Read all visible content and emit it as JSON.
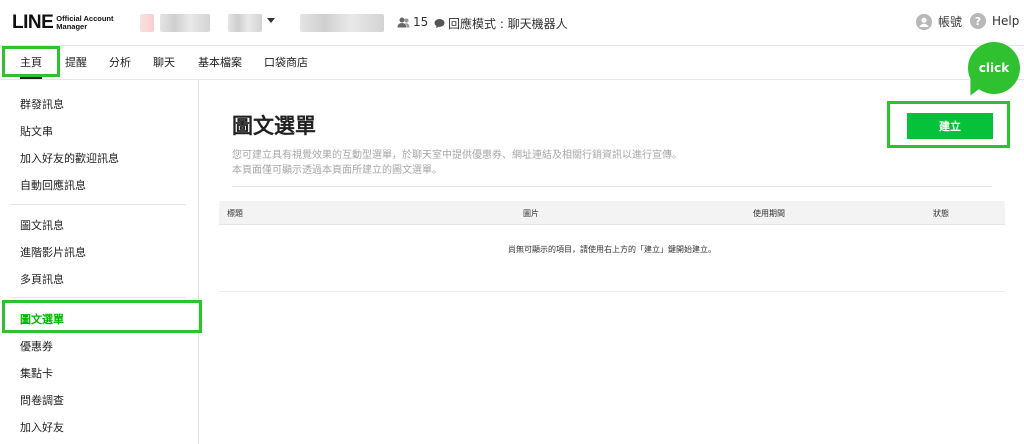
{
  "header": {
    "logo_main": "LINE",
    "logo_sub": "Official Account Manager",
    "friend_count": "15",
    "reply_mode": "回應模式 : 聊天機器人",
    "account_label": "帳號",
    "help_label": "Help"
  },
  "nav": {
    "items": [
      "主頁",
      "提醒",
      "分析",
      "聊天",
      "基本檔案",
      "口袋商店"
    ]
  },
  "sidebar": {
    "group1": [
      "群發訊息",
      "貼文串",
      "加入好友的歡迎訊息",
      "自動回應訊息"
    ],
    "group2": [
      "圖文訊息",
      "進階影片訊息",
      "多頁訊息"
    ],
    "group3": [
      "圖文選單",
      "優惠券",
      "集點卡",
      "問卷調查",
      "加入好友"
    ]
  },
  "main": {
    "title": "圖文選單",
    "desc_line1": "您可建立具有視覺效果的互動型選單，於聊天室中提供優惠券、網址連結及相關行銷資訊以進行宣傳。",
    "desc_line2": "本頁面僅可顯示透過本頁面所建立的圖文選單。",
    "create_label": "建立",
    "table_headers": [
      "標題",
      "圖片",
      "使用期間",
      "狀態"
    ],
    "empty_message": "尚無可顯示的項目，請使用右上方的「建立」鍵開始建立。"
  },
  "annotation": {
    "bubble_text": "click"
  },
  "colors": {
    "accent": "#06c13a",
    "highlight": "#2fc12f"
  }
}
